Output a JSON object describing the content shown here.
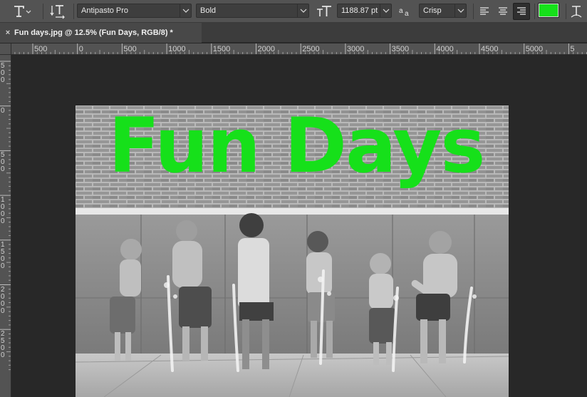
{
  "options_bar": {
    "type_tool_icon": "type-tool-icon",
    "orientation_icon": "text-orientation-icon",
    "font_family": "Antipasto Pro",
    "font_style": "Bold",
    "font_size_icon": "font-size-icon",
    "font_size": "1188.87 pt",
    "antialias_icon": "antialias-icon",
    "antialias": "Crisp",
    "align": [
      "left",
      "center",
      "right"
    ],
    "align_active": "right",
    "text_color": "#16e01a",
    "warp_icon": "warp-text-icon"
  },
  "document": {
    "tab_title": "Fun days.jpg @ 12.5% (Fun Days, RGB/8) *",
    "close_glyph": "×",
    "headline": "Fun Days"
  },
  "rulers": {
    "horizontal": [
      "500",
      "0",
      "500",
      "1000",
      "1500",
      "2000",
      "2500",
      "3000",
      "3500",
      "4000",
      "4500",
      "5000",
      "5"
    ],
    "vertical": [
      [
        "5",
        "0",
        "0"
      ],
      [
        "0"
      ],
      [
        "5",
        "0",
        "0"
      ],
      [
        "1",
        "0",
        "0",
        "0"
      ],
      [
        "1",
        "5",
        "0",
        "0"
      ],
      [
        "2",
        "0",
        "0",
        "0"
      ],
      [
        "2",
        "5",
        "0",
        "0"
      ]
    ]
  }
}
